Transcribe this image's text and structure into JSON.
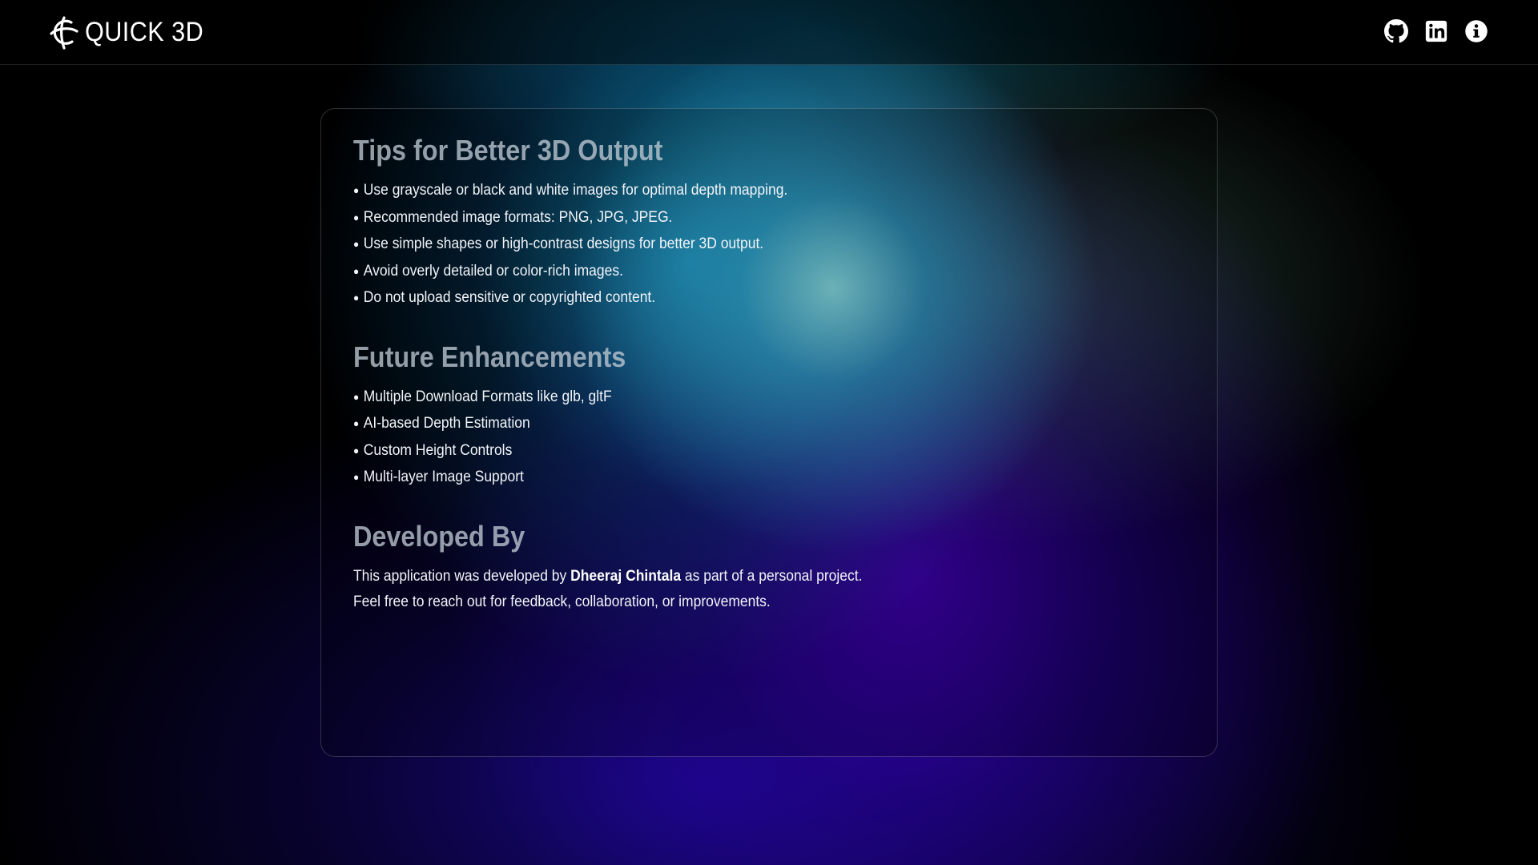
{
  "navbar": {
    "brand": "QUICK 3D",
    "icons": [
      "github-icon",
      "linkedin-icon",
      "info-icon"
    ]
  },
  "tips": {
    "title": "Tips for Better 3D Output",
    "items": [
      "Use grayscale or black and white images for optimal depth mapping.",
      "Recommended image formats: PNG, JPG, JPEG.",
      "Use simple shapes or high-contrast designs for better 3D output.",
      "Avoid overly detailed or color-rich images.",
      "Do not upload sensitive or copyrighted content."
    ]
  },
  "future": {
    "title": "Future Enhancements",
    "items": [
      "Multiple Download Formats like glb, gltF",
      "AI-based Depth Estimation",
      "Custom Height Controls",
      "Multi-layer Image Support"
    ]
  },
  "developer": {
    "title": "Developed By",
    "line1_before": "This application was developed by ",
    "name": "Dheeraj Chintala",
    "line1_after": " as part of a personal project.",
    "line2": "Feel free to reach out for feedback, collaboration, or improvements."
  }
}
